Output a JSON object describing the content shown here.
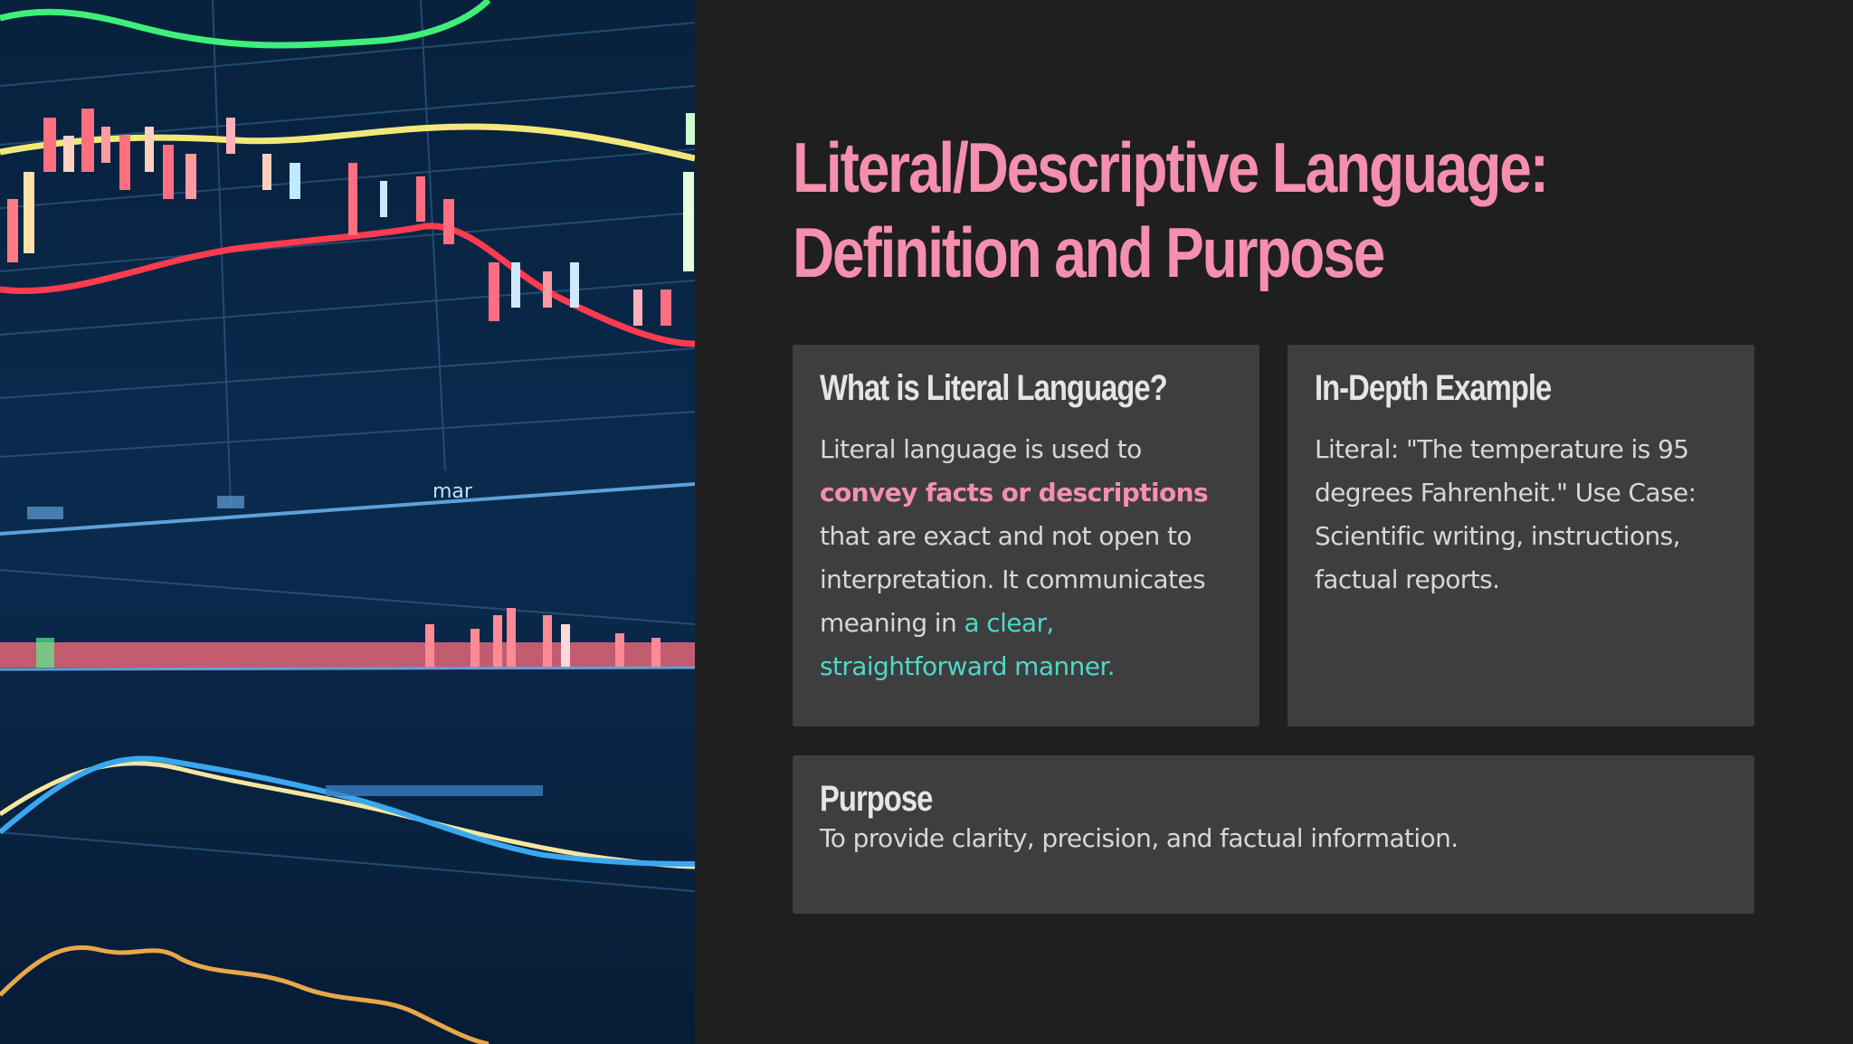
{
  "hero": {
    "axis_label": "mar"
  },
  "title": {
    "line1": "Literal/Descriptive Language:",
    "line2": "Definition and Purpose"
  },
  "cards": {
    "literal": {
      "heading": "What is Literal Language?",
      "text_before": "Literal language is used to",
      "highlight1": "convey facts or descriptions",
      "text_middle": "that are exact and not open to interpretation. It communicates meaning in",
      "highlight2": "a clear, straightforward manner."
    },
    "example": {
      "heading": "In-Depth Example",
      "line1": "Literal: \"The temperature is 95 degrees Fahrenheit.\"",
      "line2": "Use Case: Scientific writing, instructions, factual reports."
    },
    "purpose": {
      "heading": "Purpose",
      "text": "To provide clarity, precision, and factual information."
    }
  },
  "colors": {
    "background": "#1f1f1f",
    "card": "#3e3e3e",
    "accent_pink": "#f58fae",
    "accent_teal": "#4fd8c9"
  }
}
